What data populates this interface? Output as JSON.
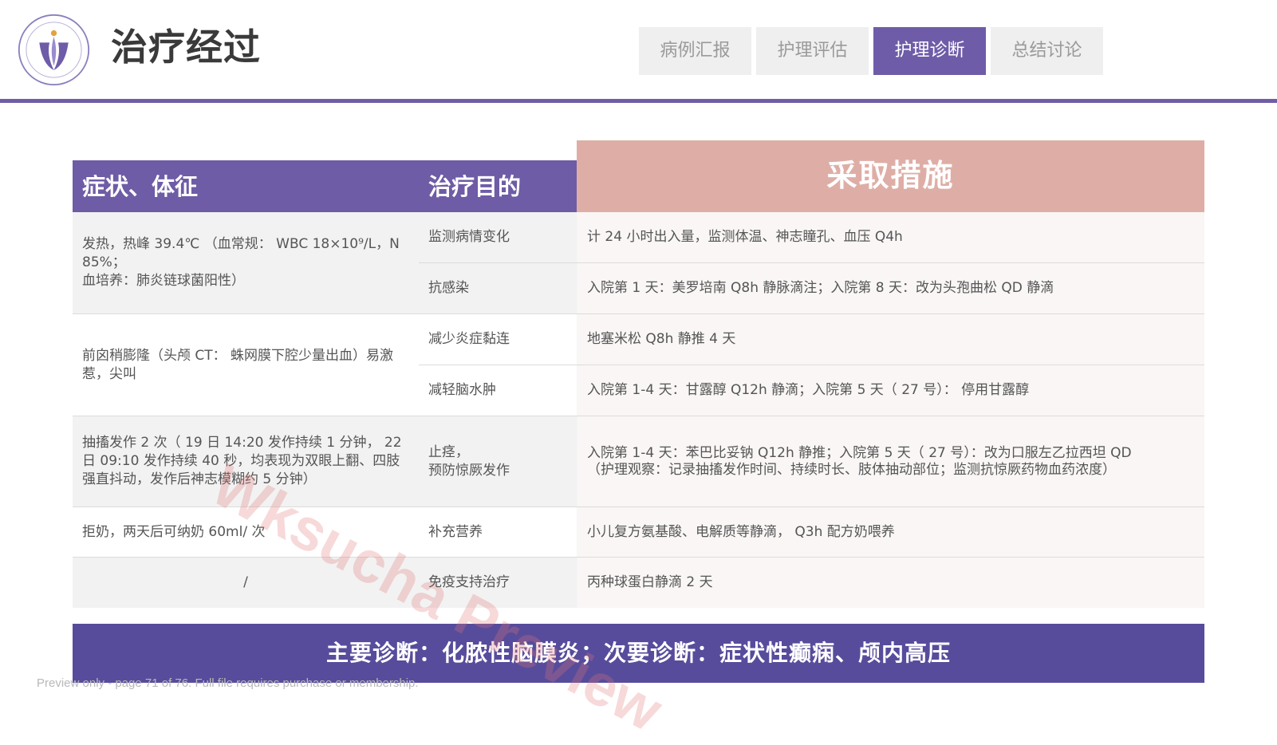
{
  "header": {
    "title": "治疗经过",
    "nav": [
      {
        "label": "病例汇报",
        "active": false
      },
      {
        "label": "护理评估",
        "active": false
      },
      {
        "label": "护理诊断",
        "active": true
      },
      {
        "label": "总结讨论",
        "active": false
      }
    ],
    "accent_color": "#6e5ca8"
  },
  "table": {
    "col_symptoms": "症状、体征",
    "col_goals": "治疗目的",
    "col_measures": "采取措施",
    "groups": [
      {
        "symptoms": "发热，热峰 39.4℃ （血常规： WBC 18×10⁹/L，N 85%；\n血培养：肺炎链球菌阳性）",
        "rows": [
          {
            "goal": "监测病情变化",
            "measure": "计 24 小时出入量，监测体温、神志瞳孔、血压 Q4h"
          },
          {
            "goal": "抗感染",
            "measure": "入院第 1 天：美罗培南 Q8h 静脉滴注；入院第 8 天：改为头孢曲松 QD 静滴"
          }
        ]
      },
      {
        "symptoms": "前囟稍膨隆（头颅 CT： 蛛网膜下腔少量出血）易激惹，尖叫",
        "rows": [
          {
            "goal": "减少炎症黏连",
            "measure": "地塞米松 Q8h 静推 4 天"
          },
          {
            "goal": "减轻脑水肿",
            "measure": "入院第 1-4 天：甘露醇 Q12h 静滴；入院第 5 天（ 27 号）： 停用甘露醇"
          }
        ]
      },
      {
        "symptoms": "抽搐发作 2 次（ 19 日 14:20 发作持续 1 分钟， 22 日 09:10 发作持续 40 秒，均表现为双眼上翻、四肢强直抖动，发作后神志模糊约 5 分钟）",
        "rows": [
          {
            "goal": "止痉，\n预防惊厥发作",
            "measure": "入院第 1-4 天：苯巴比妥钠 Q12h 静推；入院第 5 天（ 27 号）：改为口服左乙拉西坦 QD\n（护理观察：记录抽搐发作时间、持续时长、肢体抽动部位；监测抗惊厥药物血药浓度）"
          }
        ]
      },
      {
        "symptoms": "拒奶，两天后可纳奶 60ml/ 次",
        "rows": [
          {
            "goal": "补充营养",
            "measure": "小儿复方氨基酸、电解质等静滴， Q3h 配方奶喂养"
          }
        ]
      },
      {
        "symptoms": "/",
        "rows": [
          {
            "goal": "免疫支持治疗",
            "measure": "丙种球蛋白静滴 2 天"
          }
        ]
      }
    ]
  },
  "diagnosis": "主要诊断：化脓性脑膜炎；次要诊断：症状性癫痫、颅内高压",
  "watermark": "Wksucha Preview",
  "preview_note": "Preview only - page 71 of 76. Full file requires purchase or membership."
}
